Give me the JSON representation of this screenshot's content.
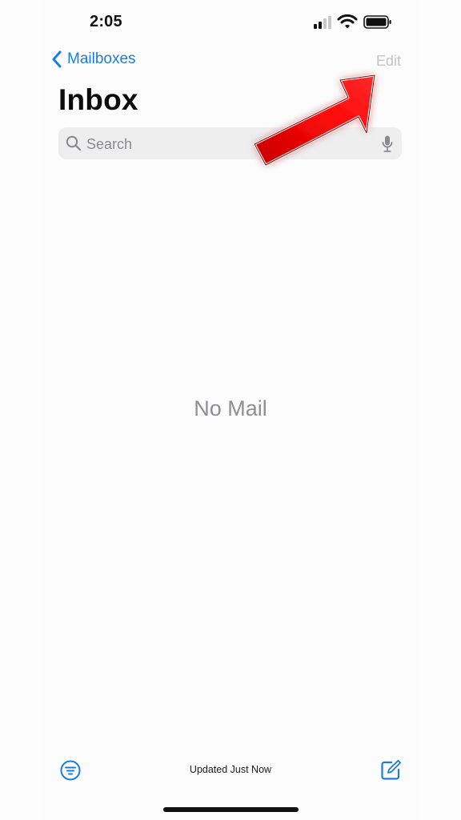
{
  "status_bar": {
    "time": "2:05",
    "icons": [
      "cellular-signal-icon",
      "wifi-icon",
      "battery-icon"
    ]
  },
  "nav": {
    "back_label": "Mailboxes",
    "back_icon": "chevron-left-icon",
    "edit_label": "Edit"
  },
  "page": {
    "title": "Inbox"
  },
  "search": {
    "placeholder": "Search",
    "value": "",
    "icon": "search-icon",
    "mic_icon": "microphone-icon"
  },
  "empty_state": {
    "message": "No Mail"
  },
  "toolbar": {
    "filter_icon": "filter-icon",
    "status": "Updated Just Now",
    "compose_icon": "compose-icon"
  },
  "annotation": {
    "icon": "red-arrow",
    "color": "#e00000"
  },
  "colors": {
    "accent": "#1a7ee0",
    "disabled": "#c4c4c4",
    "secondary_text": "#8e8e93",
    "search_bg": "#eeeeef"
  }
}
